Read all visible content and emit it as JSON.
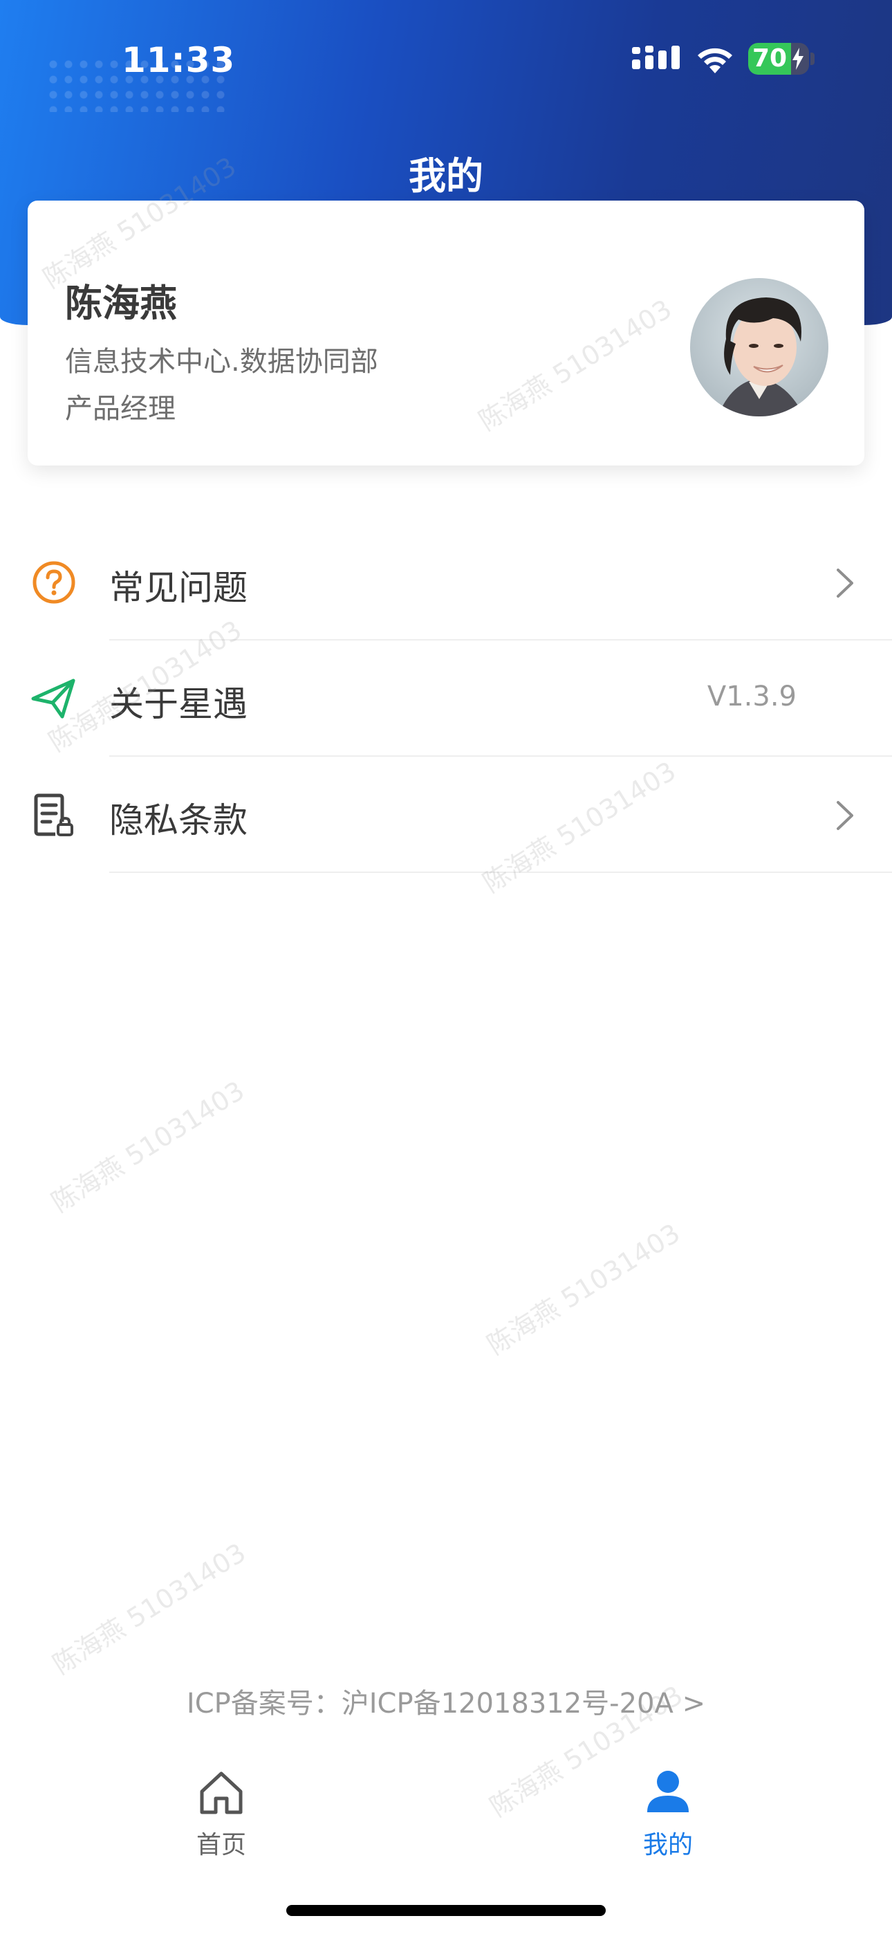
{
  "status_bar": {
    "time": "11:33",
    "battery_percent": "70",
    "battery_level": 0.7,
    "charging": true
  },
  "header": {
    "title": "我的",
    "gradient_colors": [
      "#1f7ef0",
      "#1a3a95"
    ]
  },
  "profile": {
    "name": "陈海燕",
    "department": "信息技术中心.数据协同部",
    "title": "产品经理",
    "avatar_icon": "user-avatar-photo"
  },
  "menu": [
    {
      "label": "常见问题",
      "icon": "question-circle-icon",
      "icon_color": "#f08a24",
      "value": "",
      "chevron": true
    },
    {
      "label": "关于星遇",
      "icon": "paper-plane-icon",
      "icon_color": "#1db36b",
      "value": "V1.3.9",
      "chevron": false
    },
    {
      "label": "隐私条款",
      "icon": "document-lock-icon",
      "icon_color": "#444444",
      "value": "",
      "chevron": true
    }
  ],
  "watermark": {
    "text": "陈海燕 51031403"
  },
  "footer": {
    "icp": "ICP备案号：沪ICP备12018312号-20A >"
  },
  "tabbar": [
    {
      "label": "首页",
      "icon": "home-icon",
      "active": false
    },
    {
      "label": "我的",
      "icon": "person-icon",
      "active": true
    }
  ],
  "colors": {
    "accent": "#1a7be8",
    "inactive": "#666666",
    "text_primary": "#3a3a3a",
    "text_secondary": "#6e6e6e"
  }
}
